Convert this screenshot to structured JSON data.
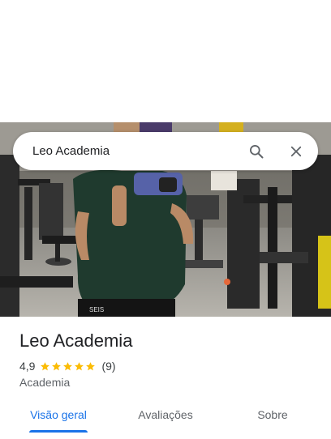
{
  "search": {
    "query": "Leo Academia"
  },
  "place": {
    "name": "Leo Academia",
    "rating": "4,9",
    "rating_value": 4.9,
    "stars": 5,
    "review_count": "(9)",
    "category": "Academia"
  },
  "tabs": [
    {
      "label": "Visão geral",
      "active": true
    },
    {
      "label": "Avaliações",
      "active": false
    },
    {
      "label": "Sobre",
      "active": false
    }
  ],
  "colors": {
    "accent": "#1a73e8",
    "star": "#fbbc04",
    "text_primary": "#202124",
    "text_secondary": "#5f6368"
  },
  "icons": {
    "search": "search-icon",
    "close": "close-icon",
    "star": "star-icon"
  }
}
